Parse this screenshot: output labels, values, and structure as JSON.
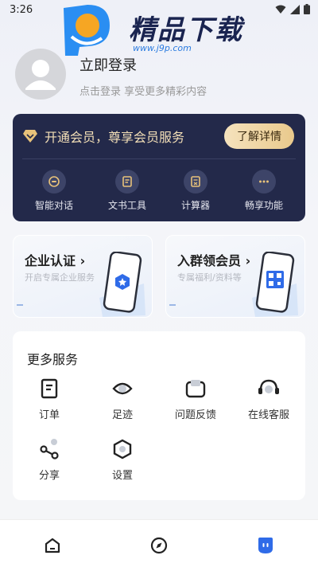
{
  "status_bar": {
    "time": "3:26"
  },
  "logo": {
    "text": "精品下载",
    "url": "www.j9p.com"
  },
  "profile": {
    "login_title": "立即登录",
    "login_subtitle": "点击登录 享受更多精彩内容"
  },
  "vip": {
    "title": "开通会员，尊享会员服务",
    "button_label": "了解详情",
    "features": [
      {
        "label": "智能对话",
        "icon": "chat-icon"
      },
      {
        "label": "文书工具",
        "icon": "document-tool-icon"
      },
      {
        "label": "计算器",
        "icon": "calculator-icon"
      },
      {
        "label": "畅享功能",
        "icon": "more-dots-icon"
      }
    ]
  },
  "promos": [
    {
      "title": "企业认证 ›",
      "subtitle": "开启专属企业服务"
    },
    {
      "title": "入群领会员 ›",
      "subtitle": "专属福利/资料等"
    }
  ],
  "services": {
    "title": "更多服务",
    "items": [
      {
        "label": "订单",
        "icon": "order-icon"
      },
      {
        "label": "足迹",
        "icon": "footprint-icon"
      },
      {
        "label": "问题反馈",
        "icon": "feedback-icon"
      },
      {
        "label": "在线客服",
        "icon": "headset-icon"
      },
      {
        "label": "分享",
        "icon": "share-icon"
      },
      {
        "label": "设置",
        "icon": "settings-icon"
      }
    ]
  },
  "tabbar": {
    "items": [
      {
        "icon": "home-icon",
        "active": false
      },
      {
        "icon": "compass-icon",
        "active": false
      },
      {
        "icon": "profile-icon",
        "active": true
      }
    ]
  },
  "colors": {
    "vip_bg": "#23294a",
    "vip_gold": "#f3dfb7",
    "accent_blue": "#2f6be8"
  }
}
